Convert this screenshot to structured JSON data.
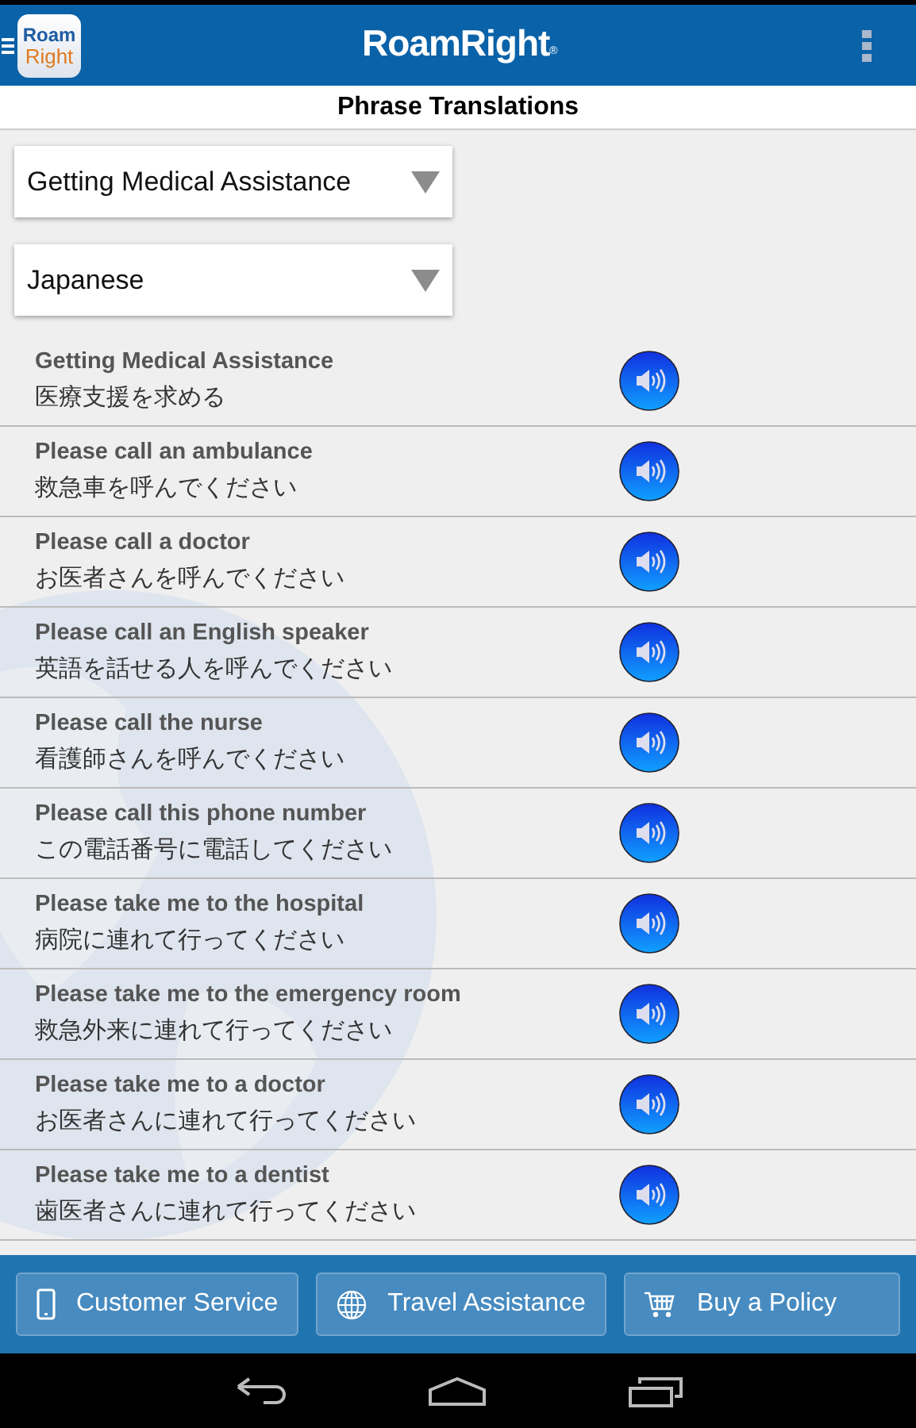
{
  "app_bar": {
    "app_icon_top": "Roam",
    "app_icon_bottom": "Right",
    "logo": "RoamRight",
    "logo_mark": "®"
  },
  "title": "Phrase Translations",
  "dropdowns": [
    {
      "value": "Getting Medical Assistance"
    },
    {
      "value": "Japanese"
    }
  ],
  "phrases": [
    {
      "english": "Getting Medical Assistance",
      "translation": "医療支援を求める"
    },
    {
      "english": "Please call an ambulance",
      "translation": "救急車を呼んでください"
    },
    {
      "english": "Please call a doctor",
      "translation": "お医者さんを呼んでください"
    },
    {
      "english": "Please call an English speaker",
      "translation": "英語を話せる人を呼んでください"
    },
    {
      "english": "Please call the nurse",
      "translation": "看護師さんを呼んでください"
    },
    {
      "english": "Please call this phone number",
      "translation": "この電話番号に電話してください"
    },
    {
      "english": "Please take me to the hospital",
      "translation": "病院に連れて行ってください"
    },
    {
      "english": "Please take me to the emergency room",
      "translation": "救急外来に連れて行ってください"
    },
    {
      "english": "Please take me to a doctor",
      "translation": "お医者さんに連れて行ってください"
    },
    {
      "english": "Please take me to a dentist",
      "translation": "歯医者さんに連れて行ってください"
    }
  ],
  "bottom_buttons": [
    {
      "kind": "phone",
      "label": "Customer Service"
    },
    {
      "kind": "globe",
      "label": "Travel Assistance"
    },
    {
      "kind": "cart",
      "label": "Buy a Policy"
    }
  ]
}
